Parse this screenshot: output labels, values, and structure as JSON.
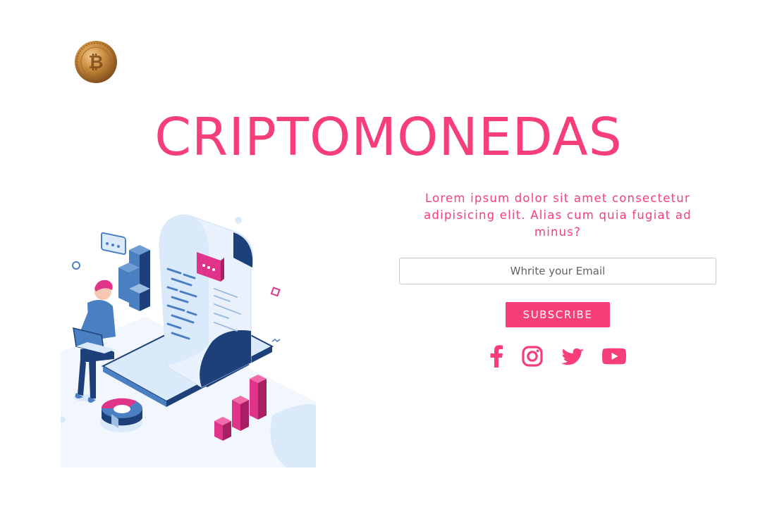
{
  "header": {
    "logo_icon": "bitcoin-coin-icon",
    "title": "CRIPTOMONEDAS"
  },
  "hero": {
    "illustration_icon": "crypto-analytics-illustration",
    "description": "Lorem ipsum dolor sit amet consectetur adipisicing elit. Alias cum quia fugiat ad minus?"
  },
  "form": {
    "email_placeholder": "Whrite your Email",
    "email_value": "",
    "subscribe_label": "SUBSCRIBE"
  },
  "social": {
    "items": [
      "facebook-icon",
      "instagram-icon",
      "twitter-icon",
      "youtube-icon"
    ]
  },
  "colors": {
    "accent": "#f63f79",
    "illustration_navy": "#1d3f7a",
    "illustration_light": "#dbeafb",
    "illustration_blue": "#4a7fc1"
  }
}
